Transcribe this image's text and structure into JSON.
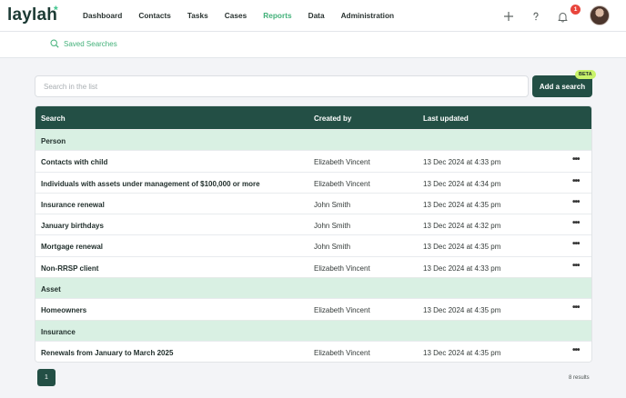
{
  "app": {
    "logo": "laylah",
    "logo_mark": "*"
  },
  "nav": [
    {
      "label": "Dashboard",
      "active": false
    },
    {
      "label": "Contacts",
      "active": false
    },
    {
      "label": "Tasks",
      "active": false
    },
    {
      "label": "Cases",
      "active": false
    },
    {
      "label": "Reports",
      "active": true
    },
    {
      "label": "Data",
      "active": false
    },
    {
      "label": "Administration",
      "active": false
    }
  ],
  "header_icons": {
    "add": "plus-icon",
    "help": "question-icon",
    "notifications": "bell-icon",
    "notification_count": "1"
  },
  "subnav": {
    "saved_searches_label": "Saved Searches",
    "icon": "search-icon"
  },
  "search": {
    "placeholder": "Search in the list",
    "value": ""
  },
  "add_button": {
    "label": "Add a search",
    "badge": "BETA"
  },
  "table": {
    "headers": {
      "search": "Search",
      "created_by": "Created by",
      "last_updated": "Last updated"
    },
    "groups": [
      {
        "label": "Person",
        "rows": [
          {
            "name": "Contacts with child",
            "created_by": "Elizabeth Vincent",
            "updated": "13 Dec 2024 at 4:33 pm"
          },
          {
            "name": "Individuals with assets under management of $100,000 or more",
            "created_by": "Elizabeth Vincent",
            "updated": "13 Dec 2024 at 4:34 pm"
          },
          {
            "name": "Insurance renewal",
            "created_by": "John Smith",
            "updated": "13 Dec 2024 at 4:35 pm"
          },
          {
            "name": "January birthdays",
            "created_by": "John Smith",
            "updated": "13 Dec 2024 at 4:32 pm"
          },
          {
            "name": "Mortgage renewal",
            "created_by": "John Smith",
            "updated": "13 Dec 2024 at 4:35 pm"
          },
          {
            "name": "Non-RRSP client",
            "created_by": "Elizabeth Vincent",
            "updated": "13 Dec 2024 at 4:33 pm"
          }
        ]
      },
      {
        "label": "Asset",
        "rows": [
          {
            "name": "Homeowners",
            "created_by": "Elizabeth Vincent",
            "updated": "13 Dec 2024 at 4:35 pm"
          }
        ]
      },
      {
        "label": "Insurance",
        "rows": [
          {
            "name": "Renewals from January to March 2025",
            "created_by": "Elizabeth Vincent",
            "updated": "13 Dec 2024 at 4:35 pm"
          }
        ]
      }
    ],
    "row_menu_icon": "more-horizontal-icon"
  },
  "pagination": {
    "current_page": "1",
    "results": "8 results"
  },
  "colors": {
    "primary": "#234f45",
    "accent": "#43b17a",
    "group_bg": "#d9f0e3",
    "badge": "#e8453c",
    "beta": "#c9f36a"
  }
}
